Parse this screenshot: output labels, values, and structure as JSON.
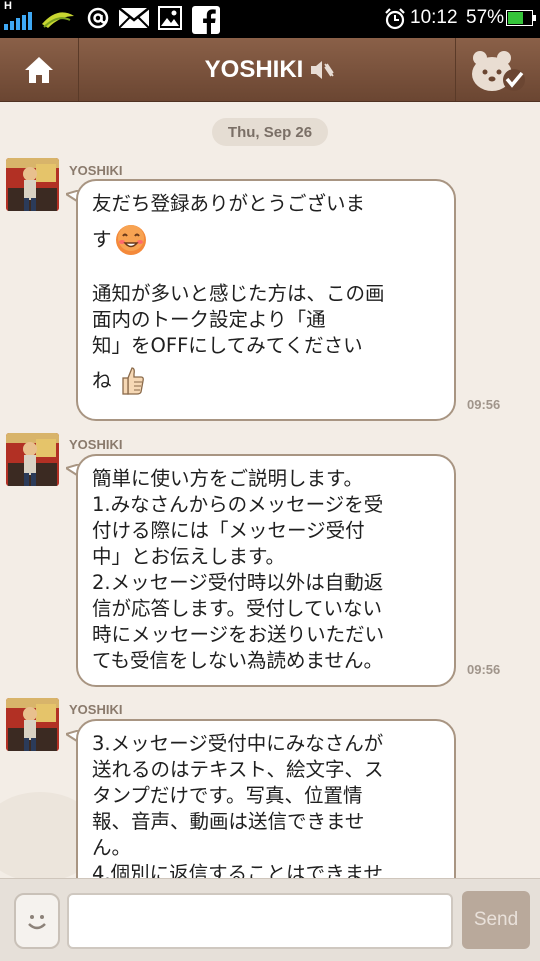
{
  "status_bar": {
    "network": "H",
    "time": "10:12",
    "battery": "57%",
    "icons": [
      "signal-icon",
      "carrier-leaf-icon",
      "at-sign-icon",
      "mail-icon",
      "image-icon",
      "facebook-icon",
      "alarm-icon",
      "battery-icon"
    ]
  },
  "header": {
    "title": "YOSHIKI",
    "home_icon": "home-icon",
    "mute_icon": "speaker-muted-icon",
    "friend_icon": "bear-check-icon"
  },
  "chat": {
    "date": "Thu, Sep 26",
    "messages": [
      {
        "sender": "YOSHIKI",
        "lines": [
          "友だち登録ありがとうございま",
          "す",
          "",
          "通知が多いと感じた方は、この画",
          "面内のトーク設定より「通",
          "知」をOFFにしてみてください",
          "ね"
        ],
        "emojis": [
          "smiling-face-emoji",
          "thumbs-up-emoji"
        ],
        "time": "09:56"
      },
      {
        "sender": "YOSHIKI",
        "lines": [
          "簡単に使い方をご説明します。",
          "1.みなさんからのメッセージを受",
          "付ける際には「メッセージ受付",
          "中」とお伝えします。",
          "2.メッセージ受付時以外は自動返",
          "信が応答します。受付していない",
          "時にメッセージをお送りいただい",
          "ても受信をしない為読めません。"
        ],
        "time": "09:56"
      },
      {
        "sender": "YOSHIKI",
        "lines": [
          "3.メッセージ受付中にみなさんが",
          "送れるのはテキスト、絵文字、ス",
          "タンプだけです。写真、位置情",
          "報、音声、動画は送信できませ",
          "ん。",
          "4.個別に返信することはできませ"
        ],
        "time": ""
      }
    ]
  },
  "input_bar": {
    "emoji_button_icon": "smiley-face-icon",
    "placeholder": "",
    "send_label": "Send"
  },
  "colors": {
    "header": "#7a5240",
    "background": "#f3ede6",
    "bubble_border": "#a89582",
    "send_button": "#b9a99b"
  }
}
